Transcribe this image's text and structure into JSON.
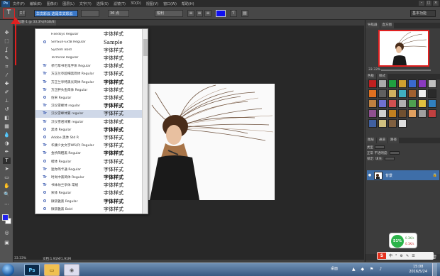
{
  "colors": {
    "accent_red": "#e02020",
    "foreground_color": "#2222ee",
    "background_color": "#ffffff",
    "selection_blue": "#3a78c8",
    "layer_selected": "#3e6ea8"
  },
  "menubar": {
    "logo": "Ps",
    "items": [
      "文件(F)",
      "编辑(E)",
      "图像(I)",
      "图层(L)",
      "文字(Y)",
      "选择(S)",
      "滤镜(T)",
      "3D(D)",
      "视图(V)",
      "窗口(W)",
      "帮助(H)"
    ],
    "minimize": "–",
    "maximize": "□",
    "close": "×"
  },
  "options": {
    "tool_icon": "T",
    "orientation_icon": "↕T",
    "font_family_value": "华文彩云 这是华文彩云",
    "font_style_value": "",
    "font_size_value": "36 点",
    "antialias_value": "锐利",
    "workspace": "基本功能"
  },
  "document": {
    "tab_label": "无标题-1 @ 33.3%(RGB/8)",
    "zoom": "33.33%",
    "doc_info": "文档:1.91M/1.91M"
  },
  "font_list": [
    {
      "name": "Fixedsys Regular",
      "sample": "字体样式",
      "icon": ""
    },
    {
      "name": "SimSun-ExtB Regular",
      "sample": "Sample",
      "icon": "O"
    },
    {
      "name": "System Bold",
      "sample": "字体样式",
      "icon": ""
    },
    {
      "name": "Terminal Regular",
      "sample": "字体样式",
      "icon": ""
    },
    {
      "name": "孝行草书毛笔字体 Regular",
      "sample": "字体样式",
      "icon": "Tr"
    },
    {
      "name": "方正兰亭超细黑简体 Regular",
      "sample": "字体样式",
      "icon": "Tr"
    },
    {
      "name": "方正兰亭特黑长简体 Regular",
      "sample": "字体样式",
      "icon": "Tr"
    },
    {
      "name": "方正胖头鱼简体 Regular",
      "sample": "字体样式",
      "icon": "Tr"
    },
    {
      "name": "仿宋 Regular",
      "sample": "字体样式",
      "icon": "O"
    },
    {
      "name": "汉仪雪峰体 regular",
      "sample": "字体样式",
      "icon": "Tr"
    },
    {
      "name": "汉仪雪峰体繁 regular",
      "sample": "字体样式",
      "icon": "Tr"
    },
    {
      "name": "汉仪雪君体繁 regular",
      "sample": "字体样式",
      "icon": "Tr"
    },
    {
      "name": "黑体 Regular",
      "sample": "字体样式",
      "icon": "O"
    },
    {
      "name": "Adobe 黑体 Std R",
      "sample": "字体样式",
      "icon": "O"
    },
    {
      "name": "华康少女文字W5(P) Regular",
      "sample": "字体样式",
      "icon": "Tr"
    },
    {
      "name": "金桥简粗黑 Regular",
      "sample": "字体样式",
      "icon": "Tr"
    },
    {
      "name": "楷体 Regular",
      "sample": "字体样式",
      "icon": "O"
    },
    {
      "name": "迷你简卡通 Regular",
      "sample": "字体样式",
      "icon": "Tr"
    },
    {
      "name": "时尚中黑简体 Regular",
      "sample": "字体样式",
      "icon": "Tr"
    },
    {
      "name": "书体坊兰亭体 常规",
      "sample": "字体样式",
      "icon": "Tr"
    },
    {
      "name": "宋体 Regular",
      "sample": "字体样式",
      "icon": "O"
    },
    {
      "name": "微软雅黑 Regular",
      "sample": "字体样式",
      "icon": "O"
    },
    {
      "name": "微软雅黑 Bold",
      "sample": "字体样式",
      "icon": "O"
    }
  ],
  "font_list_selected_index": 10,
  "navigator": {
    "tabs": [
      "导航器",
      "直方图"
    ],
    "zoom": "33.33%"
  },
  "styles_panel": {
    "tabs": [
      "色板",
      "样式"
    ]
  },
  "layers_panel": {
    "tabs": [
      "图层",
      "通道",
      "路径"
    ],
    "kind_label": "类型",
    "blend_mode": "正常",
    "opacity_label": "不透明度:",
    "lock_label": "锁定:",
    "fill_label": "填充:",
    "layer_name": "背景",
    "eye_icon": "●",
    "lock_icon": "🔒",
    "bottom_icons": [
      "fx",
      "◐",
      "□",
      "▤",
      "🗑"
    ]
  },
  "speed_widget": {
    "percent": "51%",
    "up": "0.3K/s",
    "down": "0.1K/s"
  },
  "ime": {
    "logo": "S",
    "icons": [
      "中",
      "°",
      "⚙",
      "✎",
      "☰"
    ]
  },
  "taskbar": {
    "desktop_label": "桌面",
    "tray_icons": "▲ ◆ ⚑ ♪",
    "time": "15:08",
    "date": "2016/5/24",
    "ps_label": "Ps"
  }
}
